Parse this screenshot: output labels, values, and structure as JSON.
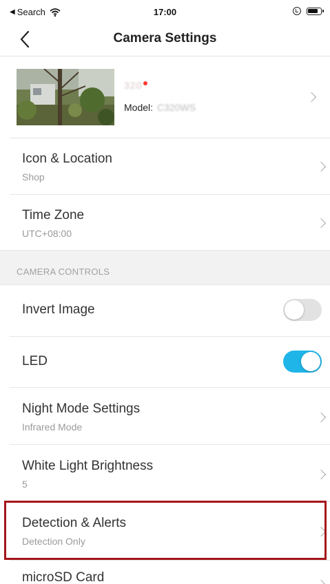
{
  "status_bar": {
    "back_app": "Search",
    "time": "17:00"
  },
  "nav": {
    "title": "Camera Settings"
  },
  "camera": {
    "name": "320",
    "model_label": "Model:",
    "model_value": "C320WS"
  },
  "rows": {
    "icon_location": {
      "title": "Icon & Location",
      "subtitle": "Shop"
    },
    "time_zone": {
      "title": "Time Zone",
      "subtitle": "UTC+08:00"
    }
  },
  "section": {
    "camera_controls": "CAMERA CONTROLS"
  },
  "controls": {
    "invert_image": {
      "title": "Invert Image",
      "enabled": false
    },
    "led": {
      "title": "LED",
      "enabled": true
    },
    "night_mode": {
      "title": "Night Mode Settings",
      "subtitle": "Infrared Mode"
    },
    "white_light": {
      "title": "White Light Brightness",
      "subtitle": "5"
    },
    "detection": {
      "title": "Detection & Alerts",
      "subtitle": "Detection Only"
    },
    "microsd": {
      "title": "microSD Card"
    }
  },
  "colors": {
    "accent": "#1fb5e8",
    "highlight": "#a3151b",
    "status_dot": "#ff3b30"
  }
}
